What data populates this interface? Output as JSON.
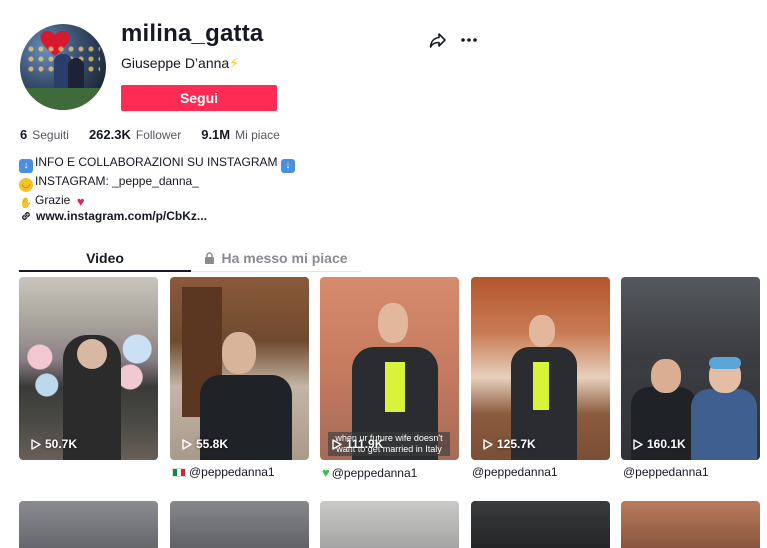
{
  "profile": {
    "username": "milina_gatta",
    "nickname": "Giuseppe D’anna",
    "nickname_emoji": "⚡",
    "follow_label": "Segui"
  },
  "stats": {
    "following_count": "6",
    "following_label": "Seguiti",
    "followers_count": "262.3K",
    "followers_label": "Follower",
    "likes_count": "9.1M",
    "likes_label": "Mi piace"
  },
  "bio": {
    "line1": "INFO E COLLABORAZIONI SU INSTAGRAM",
    "line2": "INSTAGRAM: _peppe_danna_",
    "line3": "Grazie"
  },
  "link": "www.instagram.com/p/CbKz...",
  "tabs": {
    "video": "Video",
    "liked": "Ha messo mi piace"
  },
  "videos": [
    {
      "views": "50.7K",
      "caption": ""
    },
    {
      "views": "55.8K",
      "caption": "@peppedanna1"
    },
    {
      "views": "111.9K",
      "caption": "@peppedanna1",
      "overlay": "when ur future wife doesn't want to get married in Italy"
    },
    {
      "views": "125.7K",
      "caption": "@peppedanna1"
    },
    {
      "views": "160.1K",
      "caption": "@peppedanna1"
    }
  ],
  "icons": [
    "share-icon",
    "more-icon",
    "link-icon",
    "lock-icon",
    "play-icon"
  ],
  "colors": {
    "accent": "#fe2c55",
    "text": "#161823",
    "muted": "#8a8b91"
  }
}
